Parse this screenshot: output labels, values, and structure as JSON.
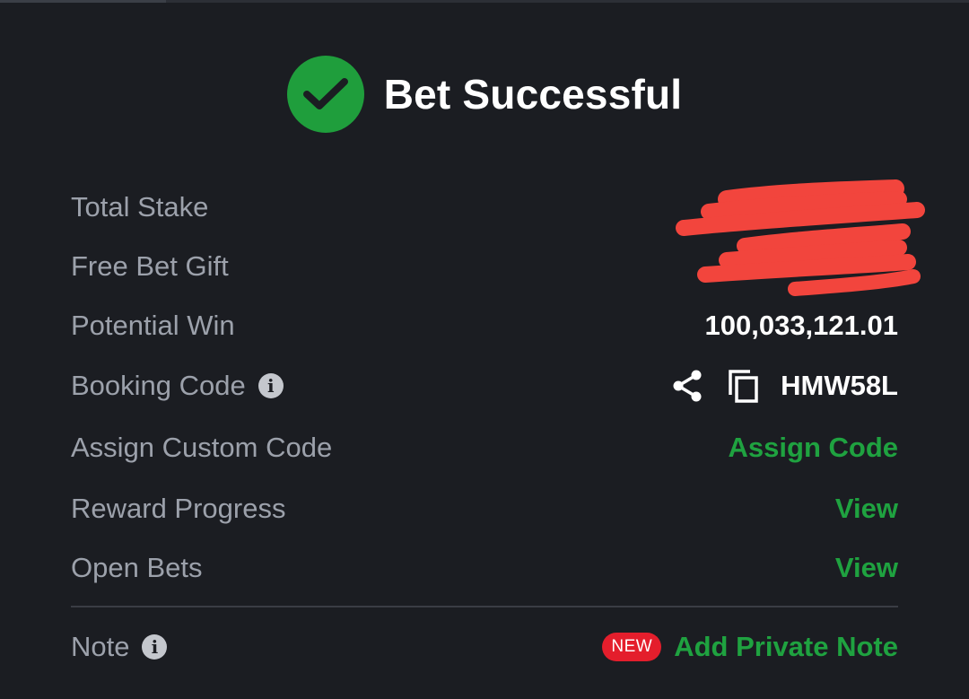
{
  "header": {
    "title": "Bet Successful",
    "status_icon": "check-circle-icon",
    "accent_color": "#1f9e3c"
  },
  "rows": {
    "total_stake": {
      "label": "Total Stake",
      "value_redacted": true
    },
    "free_bet_gift": {
      "label": "Free Bet Gift",
      "value_redacted": true
    },
    "potential_win": {
      "label": "Potential Win",
      "value": "100,033,121.01"
    },
    "booking_code": {
      "label": "Booking Code",
      "value": "HMW58L"
    },
    "assign_custom_code": {
      "label": "Assign Custom Code",
      "action": "Assign Code"
    },
    "reward_progress": {
      "label": "Reward Progress",
      "action": "View"
    },
    "open_bets": {
      "label": "Open Bets",
      "action": "View"
    },
    "note": {
      "label": "Note",
      "badge": "NEW",
      "action": "Add Private Note"
    }
  },
  "colors": {
    "background": "#1b1d22",
    "label": "#9ca1ab",
    "link": "#1fa240",
    "badge": "#e41e2c",
    "redaction": "#f2453d"
  }
}
